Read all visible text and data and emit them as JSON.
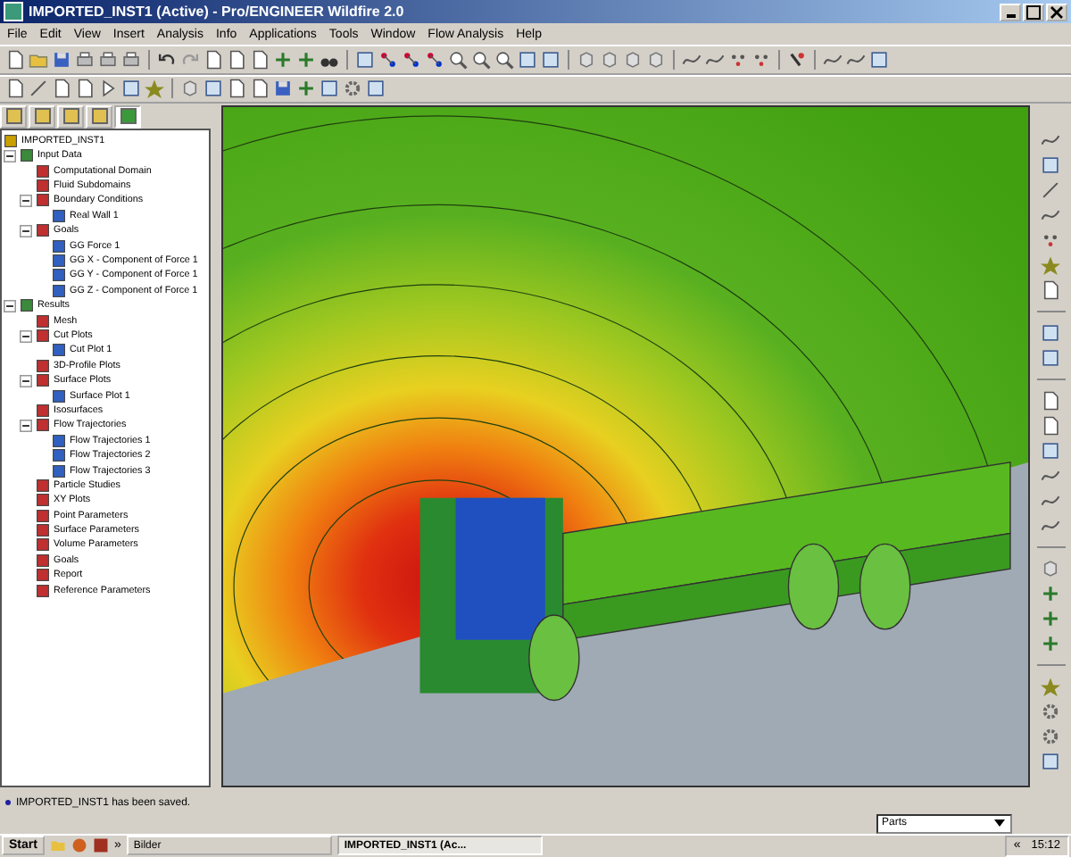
{
  "window": {
    "title": "IMPORTED_INST1 (Active) - Pro/ENGINEER Wildfire 2.0"
  },
  "menu": [
    "File",
    "Edit",
    "View",
    "Insert",
    "Analysis",
    "Info",
    "Applications",
    "Tools",
    "Window",
    "Flow Analysis",
    "Help"
  ],
  "panel_tabs": [
    {
      "selected": false
    },
    {
      "selected": false
    },
    {
      "selected": false
    },
    {
      "selected": false
    },
    {
      "selected": true
    }
  ],
  "tree": {
    "label": "IMPORTED_INST1",
    "children": [
      {
        "label": "Input Data",
        "expanded": true,
        "children": [
          {
            "label": "Computational Domain"
          },
          {
            "label": "Fluid Subdomains"
          },
          {
            "label": "Boundary Conditions",
            "expanded": true,
            "children": [
              {
                "label": "Real Wall 1"
              }
            ]
          },
          {
            "label": "Goals",
            "expanded": true,
            "children": [
              {
                "label": "GG Force 1"
              },
              {
                "label": "GG X - Component of Force 1"
              },
              {
                "label": "GG Y - Component of Force 1"
              },
              {
                "label": "GG Z - Component of Force 1"
              }
            ]
          }
        ]
      },
      {
        "label": "Results",
        "expanded": true,
        "children": [
          {
            "label": "Mesh"
          },
          {
            "label": "Cut Plots",
            "expanded": true,
            "children": [
              {
                "label": "Cut Plot 1"
              }
            ]
          },
          {
            "label": "3D-Profile Plots"
          },
          {
            "label": "Surface Plots",
            "expanded": true,
            "children": [
              {
                "label": "Surface Plot 1"
              }
            ]
          },
          {
            "label": "Isosurfaces"
          },
          {
            "label": "Flow Trajectories",
            "expanded": true,
            "children": [
              {
                "label": "Flow Trajectories 1"
              },
              {
                "label": "Flow Trajectories 2"
              },
              {
                "label": "Flow Trajectories 3"
              }
            ]
          },
          {
            "label": "Particle Studies"
          },
          {
            "label": "XY Plots"
          },
          {
            "label": "Point Parameters"
          },
          {
            "label": "Surface Parameters"
          },
          {
            "label": "Volume Parameters"
          },
          {
            "label": "Goals"
          },
          {
            "label": "Report"
          },
          {
            "label": "Reference Parameters"
          }
        ]
      }
    ]
  },
  "message": "IMPORTED_INST1 has been saved.",
  "filter": {
    "value": "Parts"
  },
  "taskbar": {
    "start": "Start",
    "more": "»",
    "buttons": [
      {
        "label": "Bilder",
        "selected": false
      },
      {
        "label": "IMPORTED_INST1 (Ac...",
        "selected": true
      }
    ],
    "tray_more": "«",
    "time": "15:12"
  }
}
